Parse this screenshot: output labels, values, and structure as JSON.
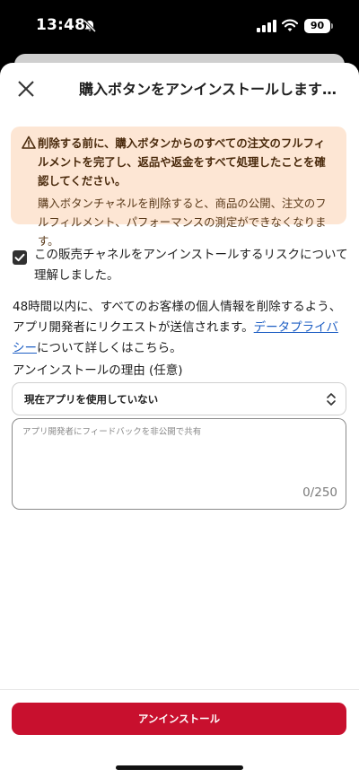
{
  "status_bar": {
    "time": "13:48",
    "battery": "90",
    "icons": [
      "bell-slash-icon",
      "cellular-signal-icon",
      "wifi-icon"
    ]
  },
  "header": {
    "title": "購入ボタンをアンインストールします…",
    "close_icon": "close-icon"
  },
  "warning": {
    "icon": "warning-triangle-icon",
    "title": "削除する前に、購入ボタンからのすべての注文のフルフィルメントを完了し、返品や返金をすべて処理したことを確認してください。",
    "body": "購入ボタンチャネルを削除すると、商品の公開、注文のフルフィルメント、パフォーマンスの測定ができなくなります。",
    "background_color": "#fde6d4"
  },
  "confirm": {
    "checked": true,
    "label": "この販売チャネルをアンインストールするリスクについて理解しました。"
  },
  "info": {
    "text_before": "48時間以内に、すべてのお客様の個人情報を削除するよう、アプリ開発者にリクエストが送信されます。",
    "link_text": "データプライバシー",
    "text_after": "について詳しくはこちら。"
  },
  "reason": {
    "label": "アンインストールの理由 (任意)",
    "selected": "現在アプリを使用していない"
  },
  "feedback": {
    "placeholder": "アプリ開発者にフィードバックを非公開で共有",
    "counter": "0/250"
  },
  "footer": {
    "button_label": "アンインストール",
    "button_color": "#c8102e"
  }
}
